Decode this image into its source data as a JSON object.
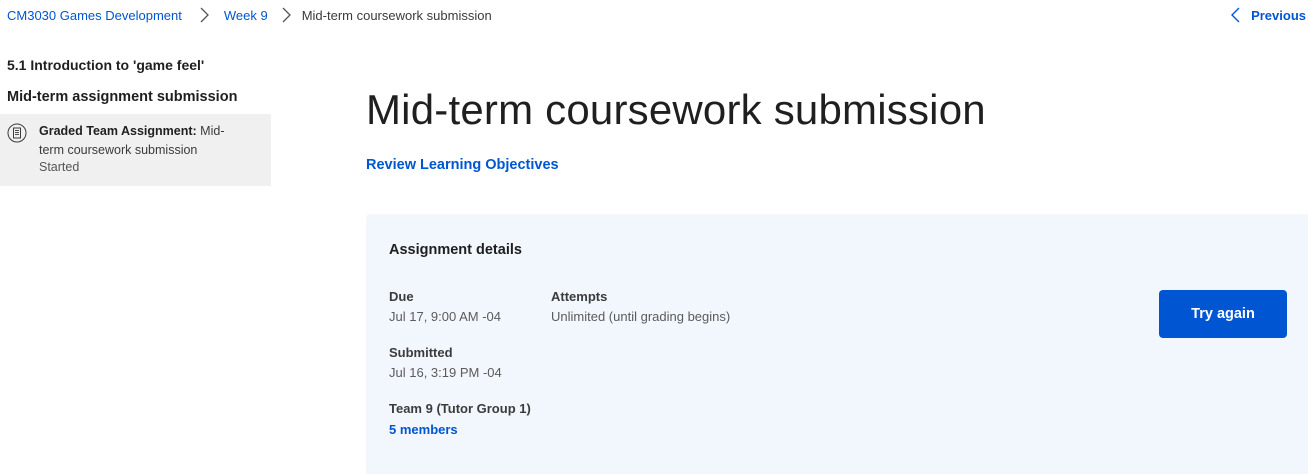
{
  "breadcrumb": {
    "course": "CM3030 Games Development",
    "week": "Week 9",
    "current": "Mid-term coursework submission"
  },
  "nav": {
    "previous": "Previous"
  },
  "sidebar": {
    "section_title": "5.1 Introduction to 'game feel'",
    "subsection_title": "Mid-term assignment submission",
    "item": {
      "type_label": "Graded Team Assignment:",
      "title": "Mid-term coursework submission",
      "status": "Started"
    }
  },
  "main": {
    "title": "Mid-term coursework submission",
    "review_link": "Review Learning Objectives"
  },
  "assignment": {
    "heading": "Assignment details",
    "due_label": "Due",
    "due_value": "Jul 17, 9:00 AM -04",
    "attempts_label": "Attempts",
    "attempts_value": "Unlimited (until grading begins)",
    "submitted_label": "Submitted",
    "submitted_value": "Jul 16, 3:19 PM -04",
    "team_label": "Team 9 (Tutor Group 1)",
    "members_link": "5 members",
    "try_again_label": "Try again"
  },
  "colors": {
    "link": "#0056d2",
    "card_bg": "#f2f6fd",
    "sidebar_active_bg": "#f0f0f0",
    "button_bg": "#0056d2"
  }
}
